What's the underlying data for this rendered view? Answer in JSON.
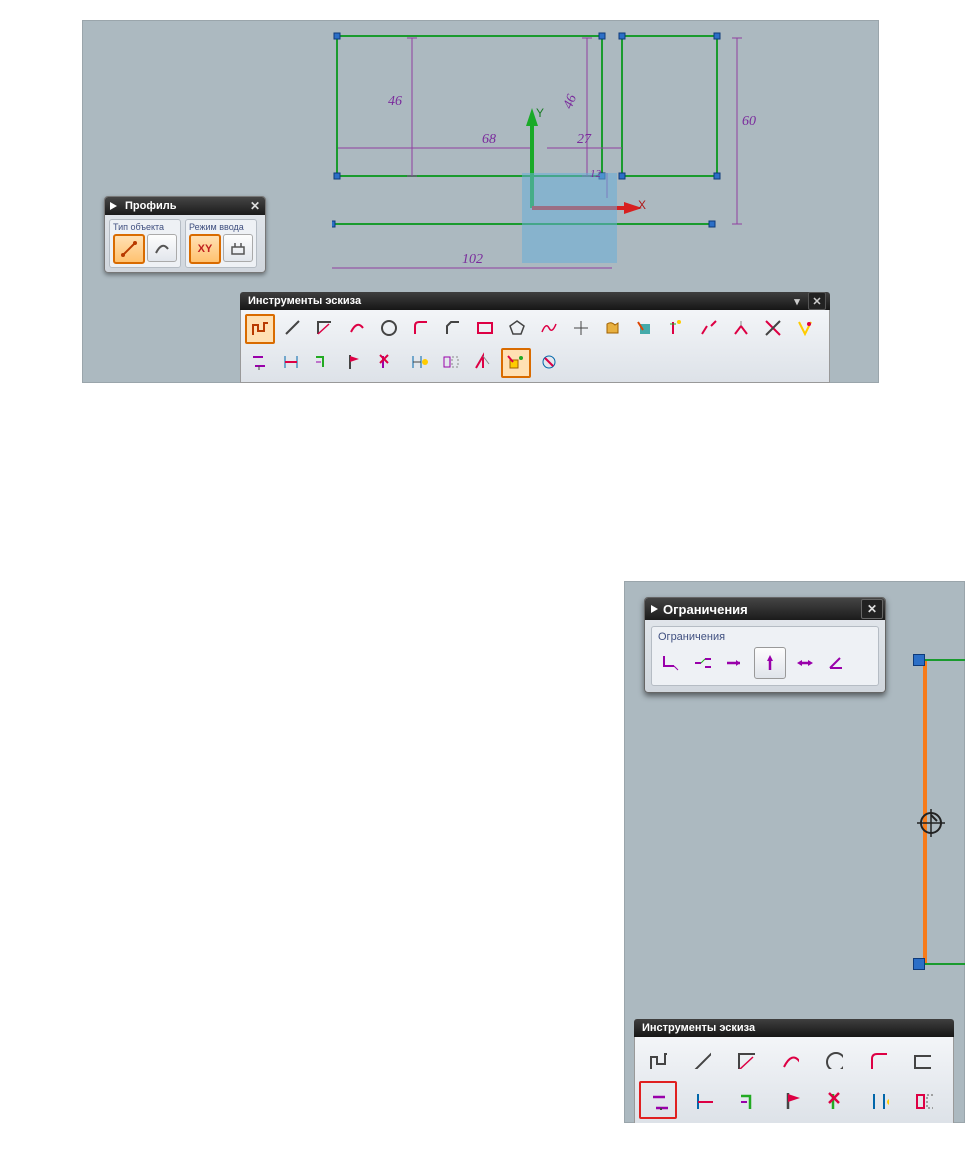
{
  "top": {
    "profile": {
      "title": "Профиль",
      "group1_label": "Тип объекта",
      "group2_label": "Режим ввода",
      "xy_text": "XY"
    },
    "dims": {
      "d46a": "46",
      "d46b": "46",
      "d68": "68",
      "d27": "27",
      "d12": "12",
      "d60": "60",
      "d102": "102"
    },
    "axes": {
      "x": "X",
      "y": "Y"
    },
    "sketch_tools_title": "Инструменты эскиза"
  },
  "bottom": {
    "constraints": {
      "title": "Ограничения",
      "group_label": "Ограничения"
    },
    "sketch_tools_title": "Инструменты эскиза"
  }
}
